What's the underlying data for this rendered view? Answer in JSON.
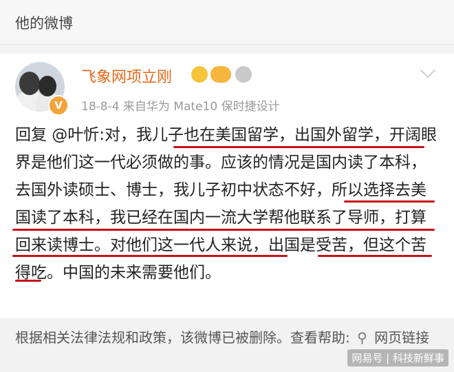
{
  "header": {
    "title": "他的微博"
  },
  "post": {
    "username": "飞象网项立刚",
    "meta": "18-8-4  来自华为 Mate10 保时捷设计",
    "badges": [
      "vip-gold-badge",
      "fish-badge",
      "medal-badge"
    ],
    "verify_icon": "V",
    "content": "回复 @叶忻:对，我儿子也在美国留学，出国外留学，开阔眼界是他们这一代必须做的事。应该的情况是国内读了本科，去国外读硕士、博士，我儿子初中状态不好，所以选择去美国读了本科，我已经在国内一流大学帮他联系了导师，打算回来读博士。对他们这一代人来说，出国是受苦，但这个苦得吃。中国的未来需要他们。"
  },
  "notice": {
    "text": "根据相关法律法规和政策，该微博已被删除。查看帮助:",
    "link_icon": "link-icon",
    "link_label": "网页链接"
  },
  "watermark": "网易号 | 科技新鲜事"
}
